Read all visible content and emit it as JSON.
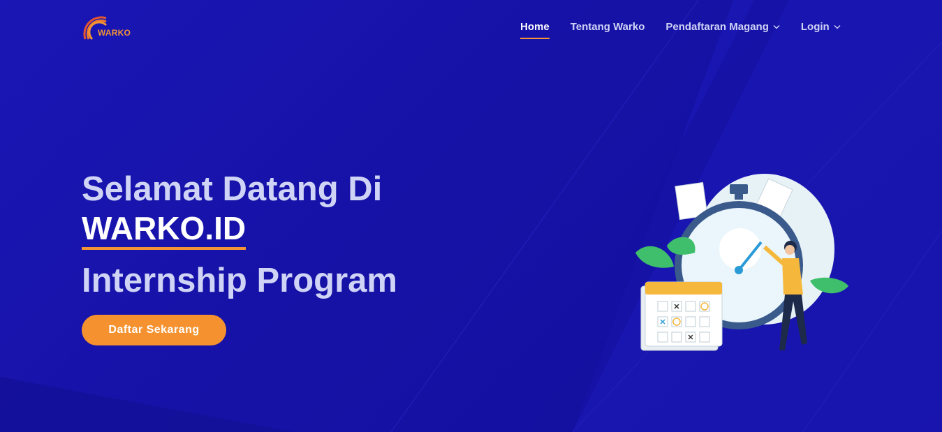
{
  "brand": {
    "logo_text": "WARKO"
  },
  "nav": {
    "items": [
      {
        "label": "Home",
        "active": true,
        "dropdown": false
      },
      {
        "label": "Tentang Warko",
        "active": false,
        "dropdown": false
      },
      {
        "label": "Pendaftaran Magang",
        "active": false,
        "dropdown": true
      },
      {
        "label": "Login",
        "active": false,
        "dropdown": true
      }
    ]
  },
  "hero": {
    "line1": "Selamat Datang Di",
    "brand": "WARKO.ID",
    "line3": "Internship Program",
    "cta_label": "Daftar Sekarang"
  },
  "colors": {
    "background": "#1613a8",
    "accent": "#f39436",
    "text_light": "#cfd3f5",
    "text_white": "#ffffff"
  }
}
